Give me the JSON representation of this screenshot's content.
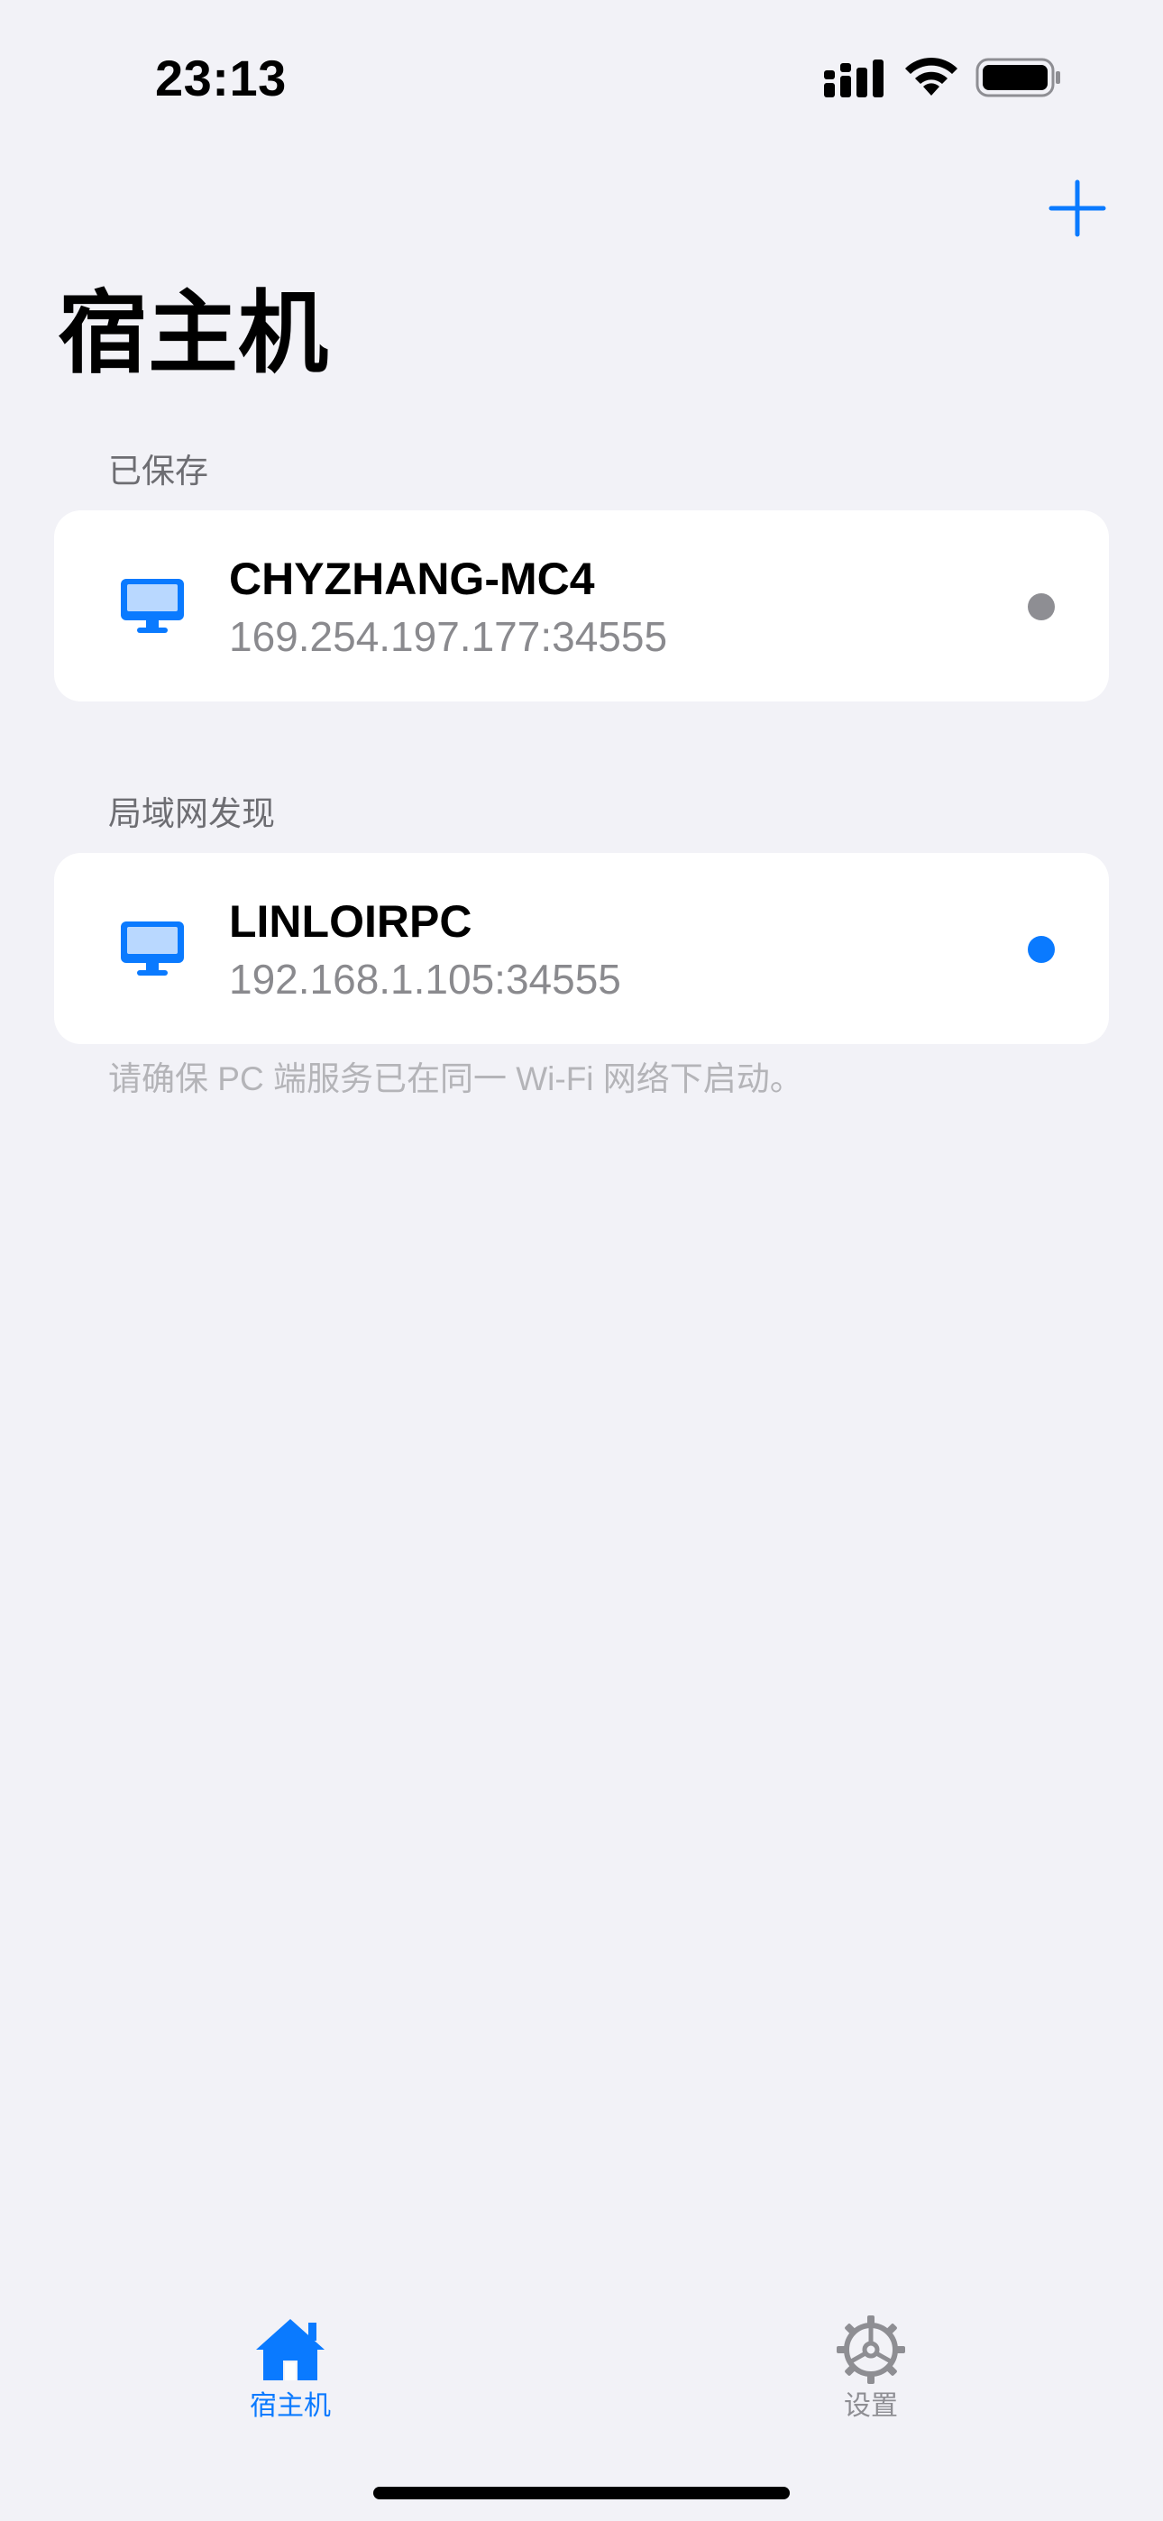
{
  "status_bar": {
    "time": "23:13"
  },
  "header": {
    "title": "宿主机",
    "add_icon": "plus-icon"
  },
  "colors": {
    "accent": "#0A7AFF",
    "background": "#F2F2F7",
    "offline": "#8E8E93",
    "online": "#0A7AFF"
  },
  "saved": {
    "header": "已保存",
    "hosts": [
      {
        "name": "CHYZHANG-MC4",
        "address": "169.254.197.177:34555",
        "status": "offline",
        "icon": "desktop-icon"
      }
    ]
  },
  "discovered": {
    "header": "局域网发现",
    "hosts": [
      {
        "name": "LINLOIRPC",
        "address": "192.168.1.105:34555",
        "status": "online",
        "icon": "desktop-icon"
      }
    ],
    "footnote": "请确保 PC 端服务已在同一 Wi-Fi 网络下启动。"
  },
  "tab_bar": {
    "tabs": [
      {
        "label": "宿主机",
        "icon": "house-icon",
        "selected": true
      },
      {
        "label": "设置",
        "icon": "gear-icon",
        "selected": false
      }
    ]
  }
}
